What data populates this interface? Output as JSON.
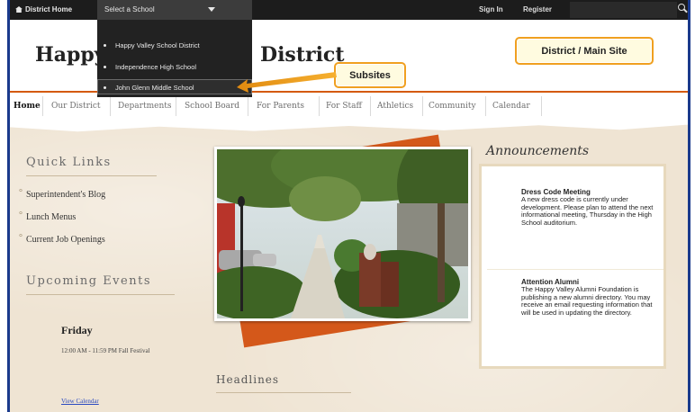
{
  "topbar": {
    "home_label": "District Home",
    "select_label": "Select a School",
    "sign_in": "Sign In",
    "register": "Register"
  },
  "dropdown": {
    "options": [
      "Happy Valley School District",
      "Independence High School",
      "John Glenn Middle School"
    ]
  },
  "header": {
    "title_left": "Happy",
    "title_right": "District",
    "callout_main": "District / Main Site",
    "callout_subsites": "Subsites"
  },
  "nav": {
    "items": [
      "Home",
      "Our District",
      "Departments",
      "School Board",
      "For Parents",
      "For Staff",
      "Athletics",
      "Community",
      "Calendar"
    ]
  },
  "quick_links": {
    "heading": "Quick Links",
    "items": [
      "Superintendent's Blog",
      "Lunch Menus",
      "Current Job Openings"
    ]
  },
  "events": {
    "heading": "Upcoming Events",
    "day": "Friday",
    "item": "12:00 AM - 11:59 PM Fall Festival",
    "view_calendar": "View Calendar"
  },
  "headlines": {
    "heading": "Headlines"
  },
  "announcements": {
    "heading": "Announcements",
    "items": [
      {
        "title": "Dress Code Meeting",
        "body": "A new dress code is currently under development. Please plan to attend the next informational meeting, Thursday in the High School auditorium."
      },
      {
        "title": "Attention Alumni",
        "body": "The Happy Valley Alumni Foundation is publishing a new alumni directory. You may receive an email requesting information that will be used in updating the directory."
      }
    ]
  },
  "colors": {
    "accent": "#d45a0c",
    "frame": "#1a3a8c",
    "callout_border": "#f0a020"
  },
  "icons": [
    "home-icon",
    "chevron-down-icon",
    "search-icon",
    "arrow-icon"
  ]
}
